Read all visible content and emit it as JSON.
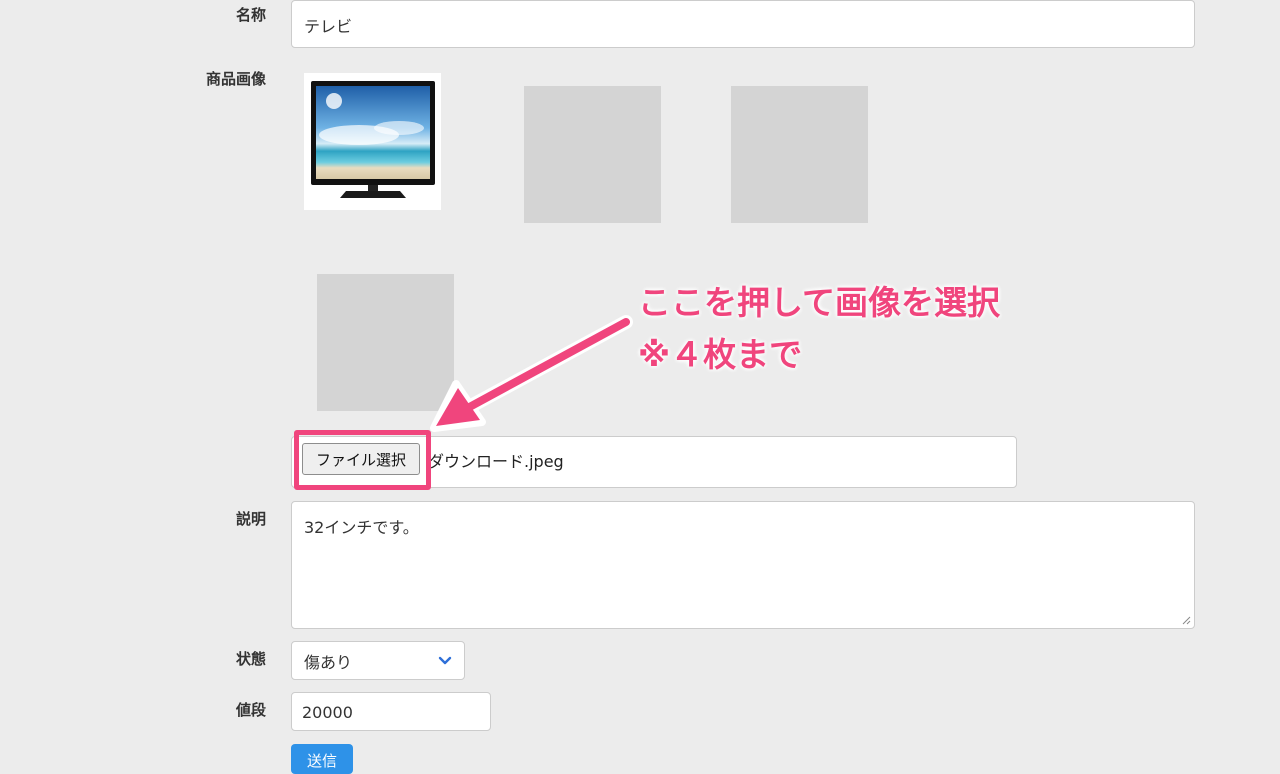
{
  "form": {
    "name": {
      "label": "名称",
      "value": "テレビ"
    },
    "images": {
      "label": "商品画像",
      "first_image": "tv-product-photo"
    },
    "file": {
      "button_label": "ファイル選択",
      "file_name": "ダウンロード.jpeg"
    },
    "description": {
      "label": "説明",
      "value": "32インチです。"
    },
    "state": {
      "label": "状態",
      "value": "傷あり"
    },
    "price": {
      "label": "値段",
      "value": "20000"
    },
    "submit_label": "送信"
  },
  "annotation": {
    "line1": "ここを押して画像を選択",
    "line2": "※４枚まで",
    "color": "#f0457d"
  },
  "colors": {
    "background": "#ececec",
    "placeholder": "#d4d4d4",
    "submit": "#2e92e8"
  }
}
